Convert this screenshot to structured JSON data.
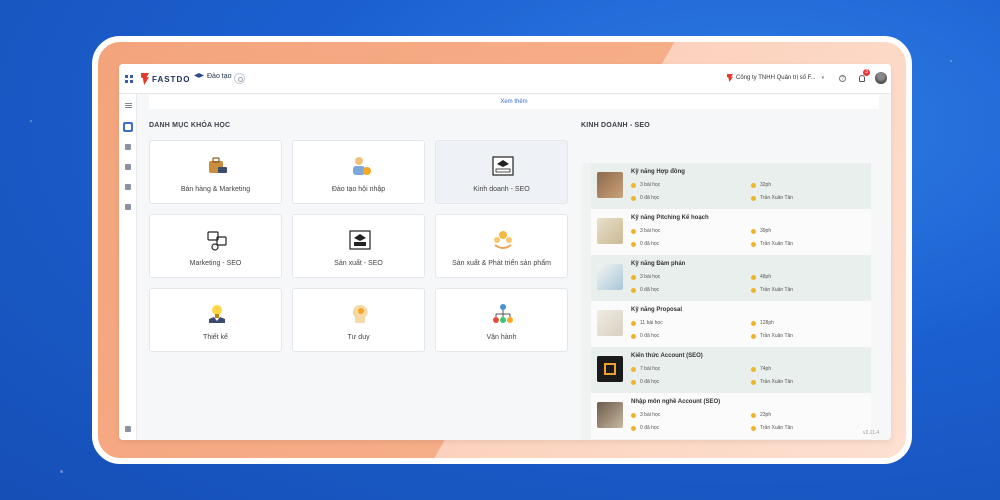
{
  "topbar": {
    "logo_text": "FASTDO",
    "nav_label": "Đào tạo",
    "company": "Công ty TNHH Quản trị số F...",
    "notifications": "3"
  },
  "banner": {
    "more_label": "Xem thêm"
  },
  "catalog": {
    "title": "DANH MỤC KHÓA HỌC",
    "categories": [
      {
        "label": "Bán hàng & Marketing"
      },
      {
        "label": "Đào tạo hội nhập"
      },
      {
        "label": "Kinh doanh - SEO"
      },
      {
        "label": "Marketing - SEO"
      },
      {
        "label": "Sản xuất - SEO"
      },
      {
        "label": "Sản xuất & Phát triển sản phẩm"
      },
      {
        "label": "Thiết kế"
      },
      {
        "label": "Tư duy"
      },
      {
        "label": "Vận hành"
      }
    ]
  },
  "seo": {
    "title": "KINH DOANH - SEO",
    "courses": [
      {
        "name": "Kỹ năng Hợp đồng",
        "lessons": "3 bài học",
        "duration": "32ph",
        "done": "0 đã học",
        "author": "Trần Xuân Tân"
      },
      {
        "name": "Kỹ năng Pitching Kế hoạch",
        "lessons": "3 bài học",
        "duration": "39ph",
        "done": "0 đã học",
        "author": "Trần Xuân Tân"
      },
      {
        "name": "Kỹ năng Đàm phán",
        "lessons": "3 bài học",
        "duration": "48ph",
        "done": "0 đã học",
        "author": "Trần Xuân Tân"
      },
      {
        "name": "Kỹ năng Proposal",
        "lessons": "11 bài học",
        "duration": "128ph",
        "done": "0 đã học",
        "author": "Trần Xuân Tân"
      },
      {
        "name": "Kiến thức Account (SEO)",
        "lessons": "7 bài học",
        "duration": "74ph",
        "done": "0 đã học",
        "author": "Trần Xuân Tân"
      },
      {
        "name": "Nhập môn nghề Account (SEO)",
        "lessons": "3 bài học",
        "duration": "23ph",
        "done": "0 đã học",
        "author": "Trần Xuân Tân"
      }
    ]
  },
  "version": "v2.11.4",
  "colors": {
    "accent": "#3d6fd1",
    "brand_red": "#e63a2e",
    "frame": "#f4a47c",
    "bg": "#1b5fcf"
  }
}
